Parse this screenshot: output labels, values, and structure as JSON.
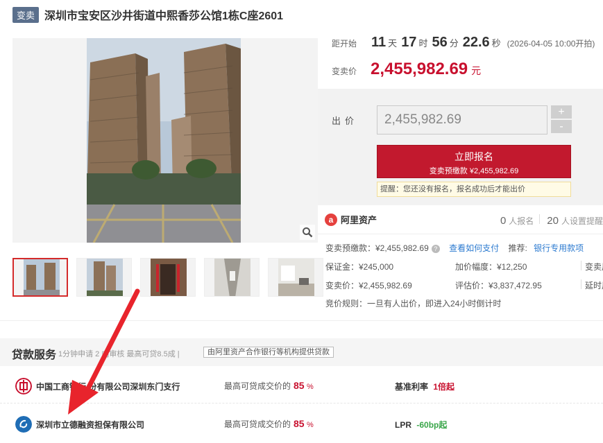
{
  "header": {
    "tag": "变卖",
    "title": "深圳市宝安区沙井街道中熙香莎公馆1栋C座2601"
  },
  "countdown": {
    "label": "距开始",
    "days": "11",
    "days_unit": "天",
    "hours": "17",
    "hours_unit": "时",
    "minutes": "56",
    "minutes_unit": "分",
    "seconds": "22.6",
    "seconds_unit": "秒",
    "start_text": "(2026-04-05 10:00开拍)"
  },
  "price": {
    "label": "变卖价",
    "value": "2,455,982.69",
    "unit": "元"
  },
  "bid": {
    "label": "出价",
    "input_value": "2,455,982.69",
    "plus": "+",
    "minus": "-",
    "signup_label": "立即报名",
    "signup_sub": "变卖预缴款 ¥2,455,982.69",
    "notice": "提醒：您还没有报名，报名成功后才能出价"
  },
  "platform": {
    "name": "阿里资产",
    "signup_count": "0",
    "signup_label": "人报名",
    "reminder_count": "20",
    "reminder_label": "人设置提醒"
  },
  "details": {
    "deposit_pre": "变卖预缴款：¥2,455,982.69",
    "how_to_pay": "查看如何支付",
    "recommend_label": "推荐:",
    "recommend_link": "银行专用款项",
    "margin": "保证金：¥245,000",
    "increment": "加价幅度：¥12,250",
    "col3_row1": "变卖周",
    "sale_price": "变卖价：¥2,455,982.69",
    "appraisal": "评估价：¥3,837,472.95",
    "col3_row2": "延时周",
    "rule": "竞价规则：一旦有人出价，即进入24小时倒计时"
  },
  "loan": {
    "title": "贷款服务",
    "subtitle": "1分钟申请 2 内审核 最高可贷8.5成 |",
    "button": "由阿里资产合作银行等机构提供贷款",
    "banks": [
      {
        "name": "中国工商银行   份有限公司深圳东门支行",
        "pct_label": "最高可贷成交价的",
        "pct": "85",
        "pct_unit": "%",
        "rate_label": "基准利率",
        "rate_value": "1倍起"
      },
      {
        "name": "深圳市立德融资担保有限公司",
        "pct_label": "最高可贷成交价的",
        "pct": "85",
        "pct_unit": "%",
        "rate_label": "LPR",
        "rate_value": "-60bp起"
      }
    ]
  },
  "colors": {
    "accent_red": "#c8102e",
    "button_red": "#c2192e",
    "link_blue": "#2d7bd0",
    "arrow_red": "#e8242c"
  }
}
